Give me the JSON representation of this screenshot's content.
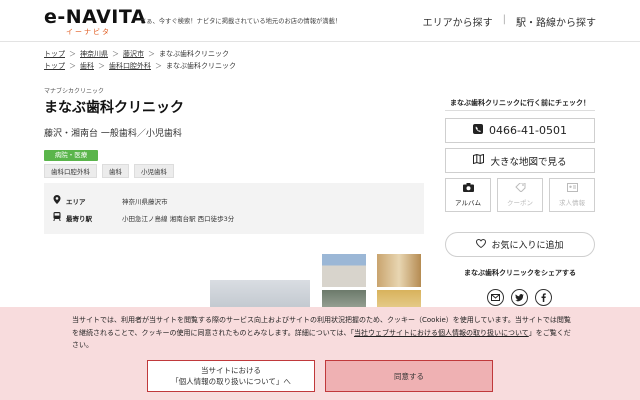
{
  "header": {
    "logo": "e-NAVITA",
    "logo_sub": "イーナビタ",
    "tagline": "さぁ、今すぐ検索！ナビタに掲載されている地元のお店の情報が満載！",
    "nav_area": "エリアから探す",
    "nav_station": "駅・路線から探す",
    "nav_sep": "|"
  },
  "breadcrumbs": {
    "row1": [
      "トップ",
      "神奈川県",
      "藤沢市",
      "まなぶ歯科クリニック"
    ],
    "row2": [
      "トップ",
      "歯科",
      "歯科口腔外科",
      "まなぶ歯科クリニック"
    ],
    "arrow": "＞"
  },
  "clinic": {
    "kana": "マナブシカクリニック",
    "name": "まなぶ歯科クリニック",
    "subtitle": "藤沢・湘南台 一般歯科／小児歯科",
    "category": "病院・医療",
    "tags": [
      "歯科口腔外科",
      "歯科",
      "小児歯科"
    ],
    "area_label": "エリア",
    "area_value": "神奈川県藤沢市",
    "station_label": "最寄り駅",
    "station_value": "小田急江ノ島線 湘南台駅 西口徒歩3分"
  },
  "sidebar": {
    "heading": "まなぶ歯科クリニックに行く前にチェック！",
    "phone": "0466-41-0501",
    "map": "大きな地図で見る",
    "album": "アルバム",
    "coupon": "クーポン",
    "jobs": "求人情報",
    "favorite": "お気に入りに追加",
    "share": "まなぶ歯科クリニックをシェアする"
  },
  "cookie": {
    "text1": "当サイトでは、利用者が当サイトを閲覧する際のサービス向上およびサイトの利用状況把握のため、クッキー（Cookie）を使用しています。当サイトでは閲覧を継続されることで、クッキーの使用に同意されたものとみなします。詳細については、「",
    "link": "当社ウェブサイトにおける個人情報の取り扱いについて",
    "text2": "」をご覧ください。",
    "btn_policy_line1": "当サイトにおける",
    "btn_policy_line2": "「個人情報の取り扱いについて」へ",
    "btn_agree": "同意する"
  },
  "colors": {
    "accent_orange": "#e05a1e",
    "badge_green": "#5ab54b",
    "cookie_bg": "#f8dcdd",
    "cookie_border": "#c0393b"
  }
}
